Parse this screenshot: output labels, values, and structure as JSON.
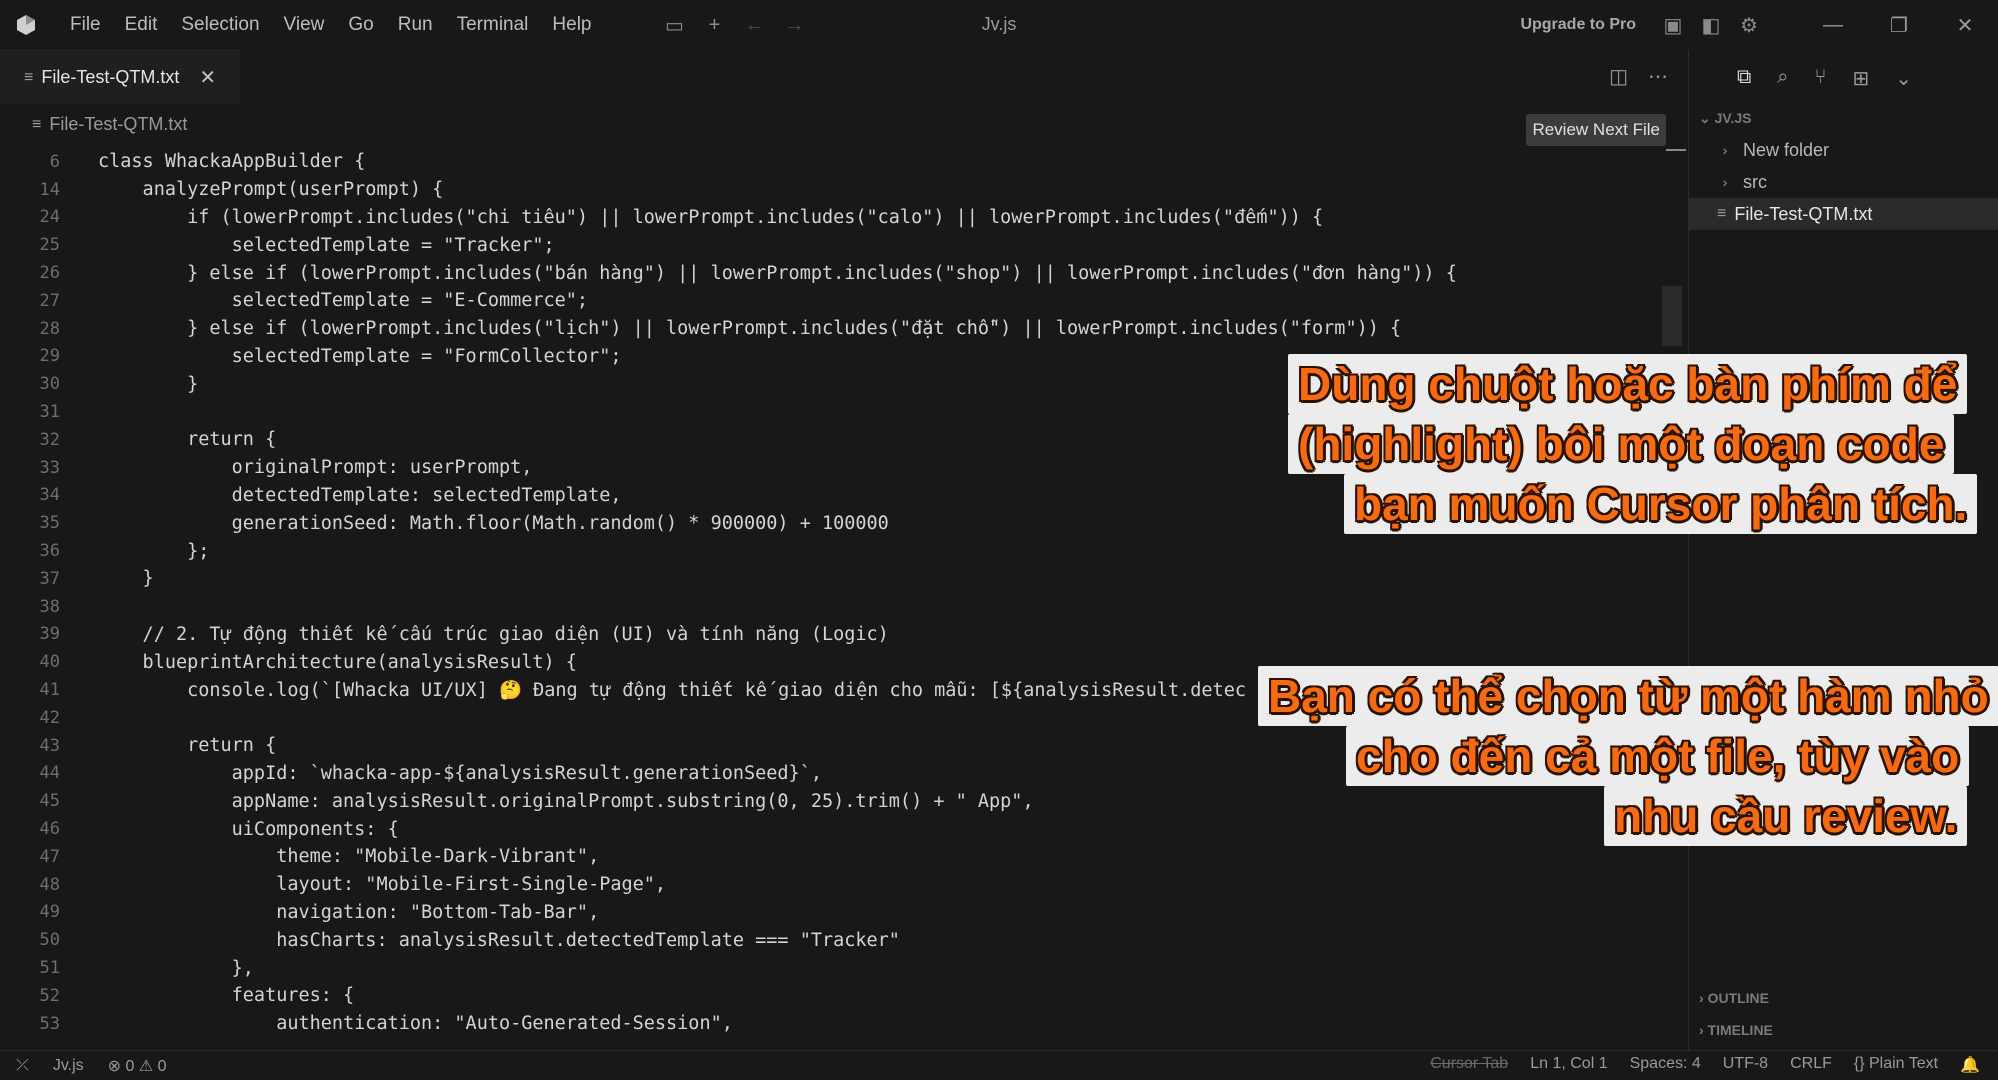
{
  "titlebar": {
    "menu": [
      "File",
      "Edit",
      "Selection",
      "View",
      "Go",
      "Run",
      "Terminal",
      "Help"
    ],
    "title": "Jv.js",
    "upgrade_label": "Upgrade to Pro"
  },
  "tab": {
    "label": "File-Test-QTM.txt",
    "close_glyph": "✕"
  },
  "breadcrumb": {
    "file": "File-Test-QTM.txt"
  },
  "review_next_file": "Review Next File",
  "code_lines": [
    {
      "n": "6",
      "t": "class WhackaAppBuilder {"
    },
    {
      "n": "14",
      "t": "    analyzePrompt(userPrompt) {"
    },
    {
      "n": "24",
      "t": "        if (lowerPrompt.includes(\"chi tiêu\") || lowerPrompt.includes(\"calo\") || lowerPrompt.includes(\"đếm\")) {"
    },
    {
      "n": "25",
      "t": "            selectedTemplate = \"Tracker\";"
    },
    {
      "n": "26",
      "t": "        } else if (lowerPrompt.includes(\"bán hàng\") || lowerPrompt.includes(\"shop\") || lowerPrompt.includes(\"đơn hàng\")) {"
    },
    {
      "n": "27",
      "t": "            selectedTemplate = \"E-Commerce\";"
    },
    {
      "n": "28",
      "t": "        } else if (lowerPrompt.includes(\"lịch\") || lowerPrompt.includes(\"đặt chỗ\") || lowerPrompt.includes(\"form\")) {"
    },
    {
      "n": "29",
      "t": "            selectedTemplate = \"FormCollector\";"
    },
    {
      "n": "30",
      "t": "        }"
    },
    {
      "n": "31",
      "t": ""
    },
    {
      "n": "32",
      "t": "        return {"
    },
    {
      "n": "33",
      "t": "            originalPrompt: userPrompt,"
    },
    {
      "n": "34",
      "t": "            detectedTemplate: selectedTemplate,"
    },
    {
      "n": "35",
      "t": "            generationSeed: Math.floor(Math.random() * 900000) + 100000"
    },
    {
      "n": "36",
      "t": "        };"
    },
    {
      "n": "37",
      "t": "    }"
    },
    {
      "n": "38",
      "t": ""
    },
    {
      "n": "39",
      "t": "    // 2. Tự động thiết kế cấu trúc giao diện (UI) và tính năng (Logic)"
    },
    {
      "n": "40",
      "t": "    blueprintArchitecture(analysisResult) {"
    },
    {
      "n": "41",
      "t": "        console.log(`[Whacka UI/UX] 🤔 Đang tự động thiết kế giao diện cho mẫu: [${analysisResult.detec"
    },
    {
      "n": "42",
      "t": ""
    },
    {
      "n": "43",
      "t": "        return {"
    },
    {
      "n": "44",
      "t": "            appId: `whacka-app-${analysisResult.generationSeed}`,"
    },
    {
      "n": "45",
      "t": "            appName: analysisResult.originalPrompt.substring(0, 25).trim() + \" App\","
    },
    {
      "n": "46",
      "t": "            uiComponents: {"
    },
    {
      "n": "47",
      "t": "                theme: \"Mobile-Dark-Vibrant\","
    },
    {
      "n": "48",
      "t": "                layout: \"Mobile-First-Single-Page\","
    },
    {
      "n": "49",
      "t": "                navigation: \"Bottom-Tab-Bar\","
    },
    {
      "n": "50",
      "t": "                hasCharts: analysisResult.detectedTemplate === \"Tracker\""
    },
    {
      "n": "51",
      "t": "            },"
    },
    {
      "n": "52",
      "t": "            features: {"
    },
    {
      "n": "53",
      "t": "                authentication: \"Auto-Generated-Session\","
    }
  ],
  "explorer": {
    "root": "JV.JS",
    "items": [
      {
        "label": "New folder",
        "type": "folder"
      },
      {
        "label": "src",
        "type": "folder"
      },
      {
        "label": "File-Test-QTM.txt",
        "type": "file"
      }
    ],
    "outline_label": "OUTLINE",
    "timeline_label": "TIMELINE"
  },
  "captions": {
    "top": [
      "Dùng chuột hoặc bàn phím để",
      "(highlight) bôi một đoạn code",
      "bạn muốn Cursor phân tích."
    ],
    "bottom": [
      "Bạn có thể chọn từ một hàm nhỏ",
      "cho đến cả một file, tùy vào",
      "nhu cầu review."
    ]
  },
  "statusbar": {
    "branch": "Jv.js",
    "errors": "0",
    "warnings": "0",
    "cursor_tab": "Cursor Tab",
    "position": "Ln 1, Col 1",
    "spaces": "Spaces: 4",
    "encoding": "UTF-8",
    "eol": "CRLF",
    "language": "Plain Text"
  },
  "colors": {
    "background": "#181818",
    "caption_text": "#f56a12",
    "caption_bg": "#ececec"
  }
}
